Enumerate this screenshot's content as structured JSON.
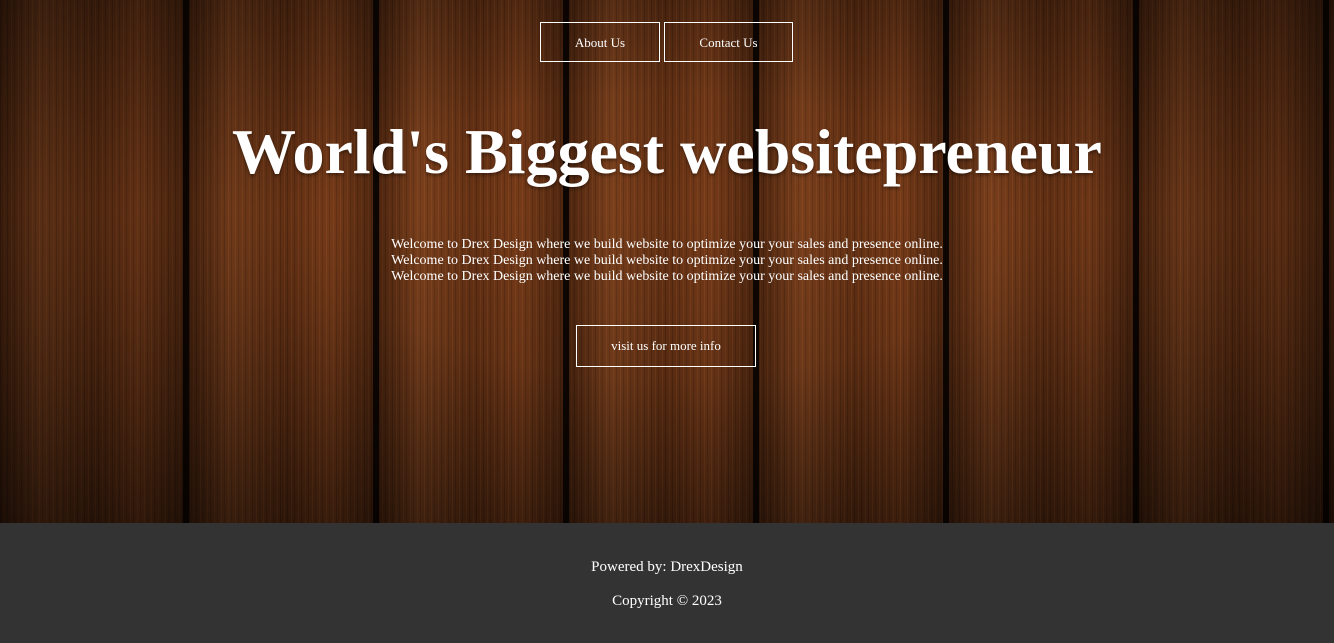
{
  "nav": {
    "about_label": "About Us",
    "contact_label": "Contact Us"
  },
  "hero": {
    "title": "World's Biggest websitepreneur",
    "intro_lines": [
      "Welcome to Drex Design where we build website to optimize your your sales and presence online.",
      "Welcome to Drex Design where we build website to optimize your your sales and presence online.",
      "Welcome to Drex Design where we build website to optimize your your sales and presence online."
    ],
    "cta_label": "visit us for more info"
  },
  "footer": {
    "powered_by": "Powered by: DrexDesign",
    "copyright": "Copyright © 2023"
  },
  "colors": {
    "footer_bg": "#333333",
    "text": "#ffffff",
    "wood": "#6b3415"
  }
}
